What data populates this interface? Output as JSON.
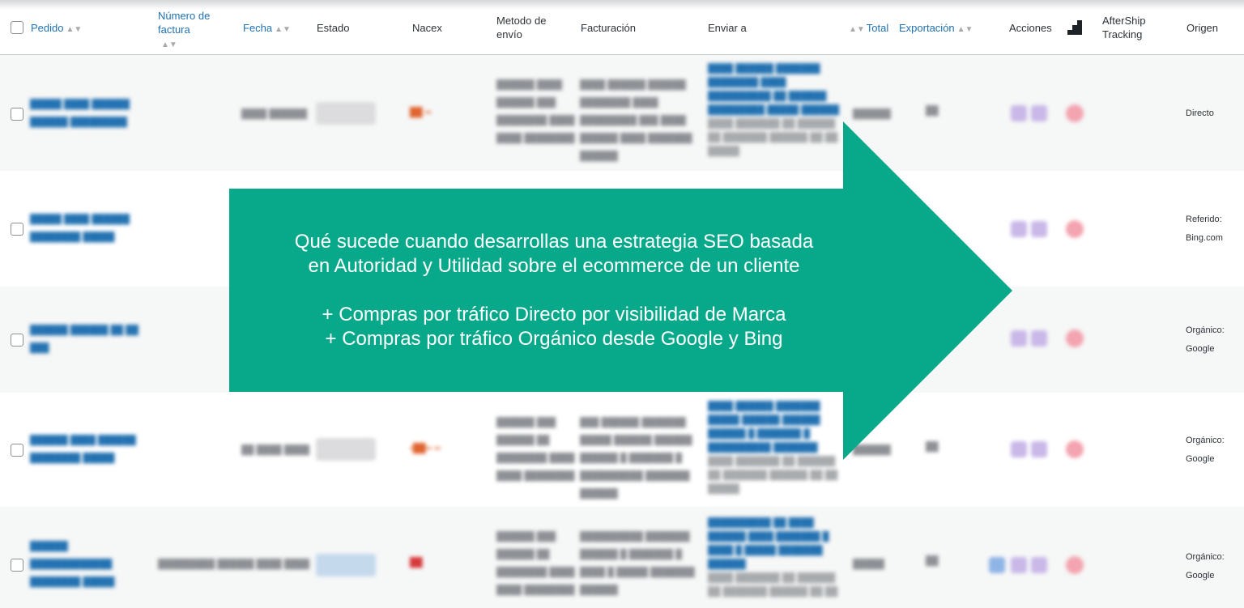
{
  "table": {
    "headers": {
      "order": "Pedido",
      "invoice_line1": "Número de",
      "invoice_line2": "factura",
      "date": "Fecha",
      "status": "Estado",
      "nacex": "Nacex",
      "shipping_line1": "Metodo de",
      "shipping_line2": "envío",
      "billing": "Facturación",
      "ship_to": "Enviar a",
      "total": "Total",
      "export": "Exportación",
      "actions": "Acciones",
      "aftership_line1": "AfterShip",
      "aftership_line2": "Tracking",
      "origin": "Origen"
    },
    "rows": [
      {
        "origin_line1": "Directo",
        "origin_line2": ""
      },
      {
        "origin_line1": "Referido:",
        "origin_line2": "Bing.com"
      },
      {
        "origin_line1": "Orgánico:",
        "origin_line2": "Google"
      },
      {
        "origin_line1": "Orgánico:",
        "origin_line2": "Google"
      },
      {
        "origin_line1": "Orgánico:",
        "origin_line2": "Google"
      }
    ]
  },
  "overlay": {
    "line1": "Qué sucede cuando desarrollas una estrategia SEO basada",
    "line2": "en Autoridad y Utilidad sobre el ecommerce de un cliente",
    "line3": "+ Compras por tráfico Directo por visibilidad de Marca",
    "line4": "+ Compras por tráfico Orgánico desde Google y Bing",
    "color": "#08a98a"
  },
  "colors": {
    "link": "#2271b1",
    "row_alt": "#f6f7f7",
    "border": "#c3c4c7"
  }
}
